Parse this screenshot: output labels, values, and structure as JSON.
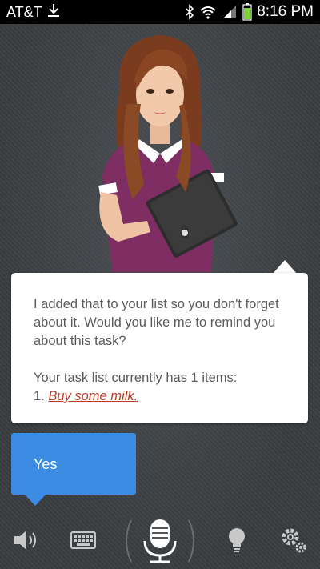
{
  "status_bar": {
    "carrier": "AT&T",
    "time": "8:16 PM",
    "icons": [
      "download-icon",
      "bluetooth-icon",
      "wifi-icon",
      "signal-icon",
      "battery-icon"
    ]
  },
  "assistant_message": {
    "paragraph1": "I added that to your list so you don't forget about it. Would you like me to remind you about this task?",
    "paragraph2_prefix": "Your task list currently has 1 items:",
    "task_number": "1.",
    "task_text": "Buy some milk."
  },
  "user_reply": {
    "label": "Yes"
  },
  "bottom_bar": {
    "buttons": [
      "speaker-icon",
      "keyboard-icon",
      "microphone-icon",
      "lightbulb-icon",
      "settings-icon"
    ]
  },
  "colors": {
    "accent_blue": "#3d8ce3",
    "link_red": "#c0392b",
    "background": "#3a3d40"
  }
}
